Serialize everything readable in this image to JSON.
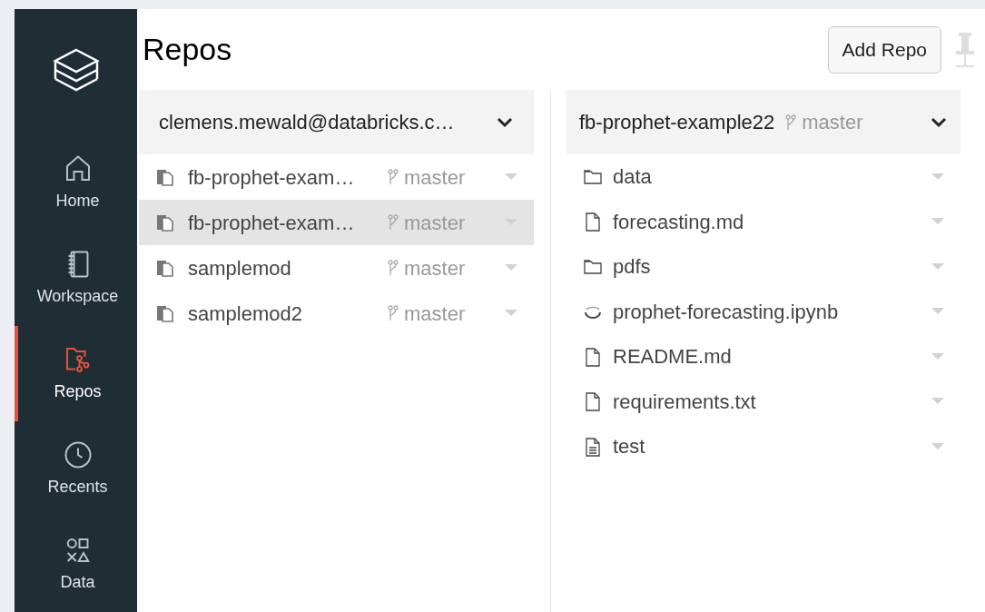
{
  "sidebar": {
    "items": [
      {
        "label": "Home",
        "kind": "home",
        "selected": false
      },
      {
        "label": "Workspace",
        "kind": "workspace",
        "selected": false
      },
      {
        "label": "Repos",
        "kind": "repos",
        "selected": true
      },
      {
        "label": "Recents",
        "kind": "recents",
        "selected": false
      },
      {
        "label": "Data",
        "kind": "data",
        "selected": false
      }
    ]
  },
  "title": "Repos",
  "add_button": "Add Repo",
  "left_panel": {
    "header": "clemens.mewald@databricks.c…",
    "rows": [
      {
        "name": "fb-prophet-exam…",
        "branch": "master",
        "selected": false
      },
      {
        "name": "fb-prophet-exam…",
        "branch": "master",
        "selected": true
      },
      {
        "name": "samplemod",
        "branch": "master",
        "selected": false
      },
      {
        "name": "samplemod2",
        "branch": "master",
        "selected": false
      }
    ]
  },
  "right_panel": {
    "header": "fb-prophet-example22",
    "branch": "master",
    "items": [
      {
        "name": "data",
        "kind": "folder"
      },
      {
        "name": "forecasting.md",
        "kind": "file"
      },
      {
        "name": "pdfs",
        "kind": "folder"
      },
      {
        "name": "prophet-forecasting.ipynb",
        "kind": "loading"
      },
      {
        "name": "README.md",
        "kind": "file"
      },
      {
        "name": "requirements.txt",
        "kind": "file"
      },
      {
        "name": "test",
        "kind": "document"
      }
    ]
  }
}
